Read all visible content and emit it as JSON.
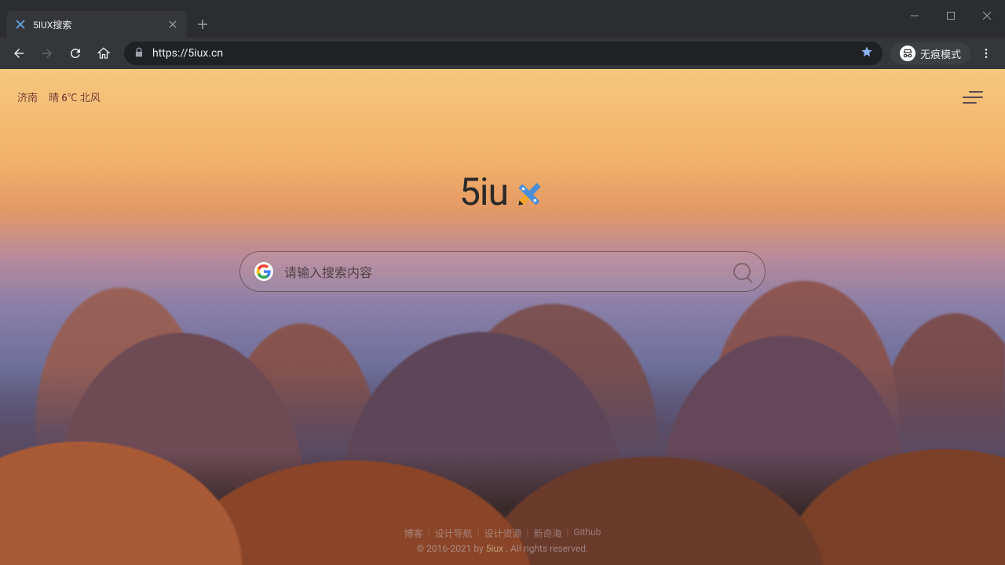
{
  "window": {
    "tab_title": "5IUX搜索"
  },
  "toolbar": {
    "url": "https://5iux.cn",
    "incognito_label": "无痕模式"
  },
  "page": {
    "weather": {
      "city": "济南",
      "detail": "晴 6℃ 北风"
    },
    "logo_text_1": "5iu",
    "logo_text_2": "",
    "search_placeholder": "请输入搜索内容",
    "footer_links": [
      "博客",
      "设计导航",
      "设计资源",
      "新奇海",
      "Github"
    ],
    "copyright_prefix": "© 2016-2021 by ",
    "copyright_brand": "5iux",
    "copyright_suffix": " . All rights reserved."
  }
}
